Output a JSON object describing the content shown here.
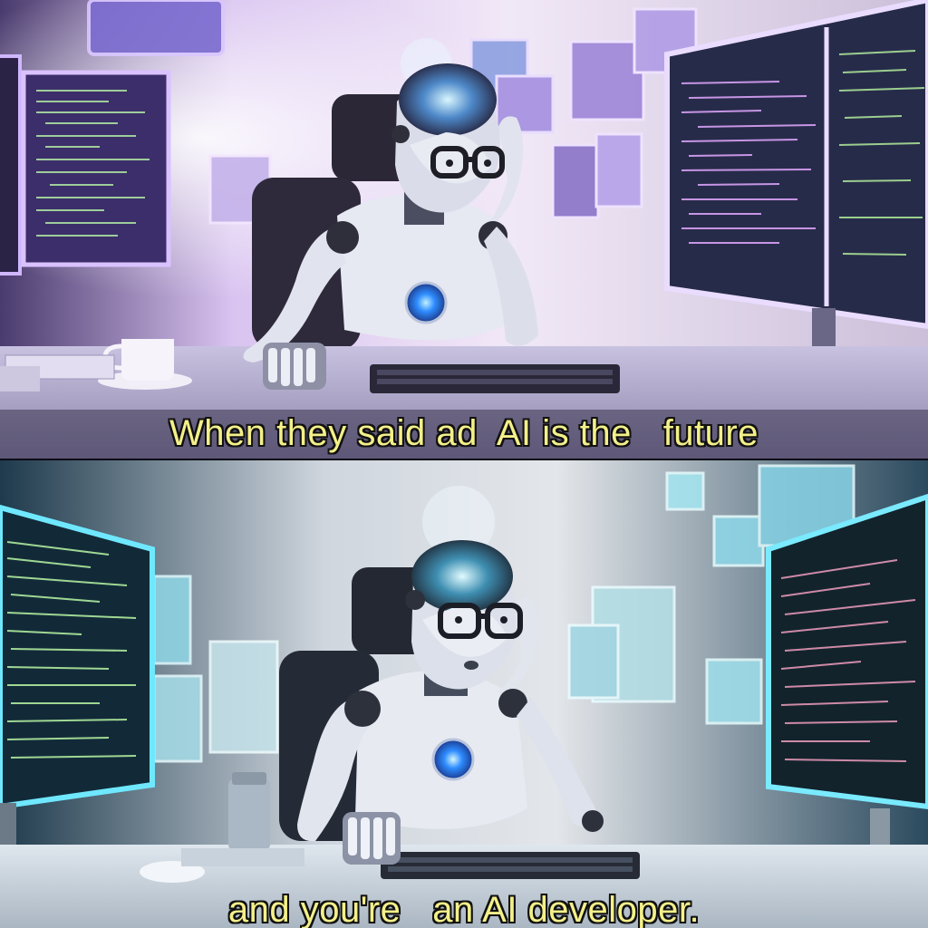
{
  "captions": {
    "top": "When they said ad  AI is the   future",
    "bottom": "and you're   an AI developer."
  },
  "colors": {
    "top_tint": "#b99be0",
    "bottom_tint": "#7fd6f0",
    "caption_text": "#f4f08a",
    "robot_body": "#e6e8f2",
    "robot_eye_glow": "#2e8cff",
    "screen_glow_top": "#c59cff",
    "screen_glow_bottom": "#5fe3ff"
  },
  "icons": {
    "top_subject": "robot-icon",
    "bottom_subject": "robot-icon"
  }
}
